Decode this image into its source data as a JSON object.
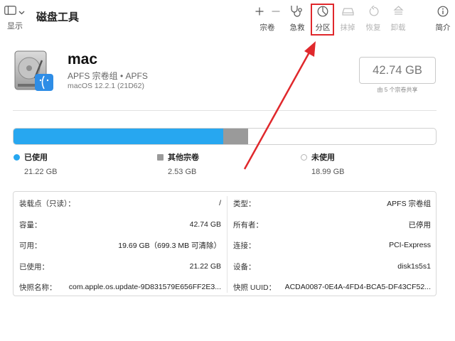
{
  "window": {
    "title": "磁盘工具",
    "view_label": "显示"
  },
  "toolbar": {
    "volume_label": "宗卷",
    "firstaid_label": "急救",
    "partition_label": "分区",
    "erase_label": "抹掉",
    "restore_label": "恢复",
    "unmount_label": "卸载",
    "info_label": "简介"
  },
  "volume": {
    "name": "mac",
    "type": "APFS 宗卷组 • APFS",
    "os": "macOS 12.2.1 (21D62)",
    "capacity": "42.74 GB",
    "capacity_note": "由 5 个宗卷共享"
  },
  "usage": {
    "fractions": {
      "used": 0.4965,
      "other": 0.0592,
      "free": 0.4443
    },
    "colors": {
      "used": "#27a7f0",
      "other": "#9a9a9a",
      "free": "#ffffff"
    },
    "used_label": "已使用",
    "used_value": "21.22 GB",
    "other_label": "其他宗卷",
    "other_value": "2.53 GB",
    "free_label": "未使用",
    "free_value": "18.99 GB"
  },
  "info": {
    "left": [
      {
        "key": "装载点（只读）：",
        "value": "/"
      },
      {
        "key": "容量：",
        "value": "42.74 GB"
      },
      {
        "key": "可用：",
        "value": "19.69 GB（699.3 MB 可清除）"
      },
      {
        "key": "已使用：",
        "value": "21.22 GB"
      },
      {
        "key": "快照名称：",
        "value": "com.apple.os.update-9D831579E656FF2E3..."
      }
    ],
    "right": [
      {
        "key": "类型：",
        "value": "APFS 宗卷组"
      },
      {
        "key": "所有者：",
        "value": "已停用"
      },
      {
        "key": "连接：",
        "value": "PCI-Express"
      },
      {
        "key": "设备：",
        "value": "disk1s5s1"
      },
      {
        "key": "快照 UUID：",
        "value": "ACDA0087-0E4A-4FD4-BCA5-DF43CF52..."
      }
    ]
  },
  "annotation": {
    "highlight_color": "#e0282c",
    "highlight_target": "分区"
  }
}
